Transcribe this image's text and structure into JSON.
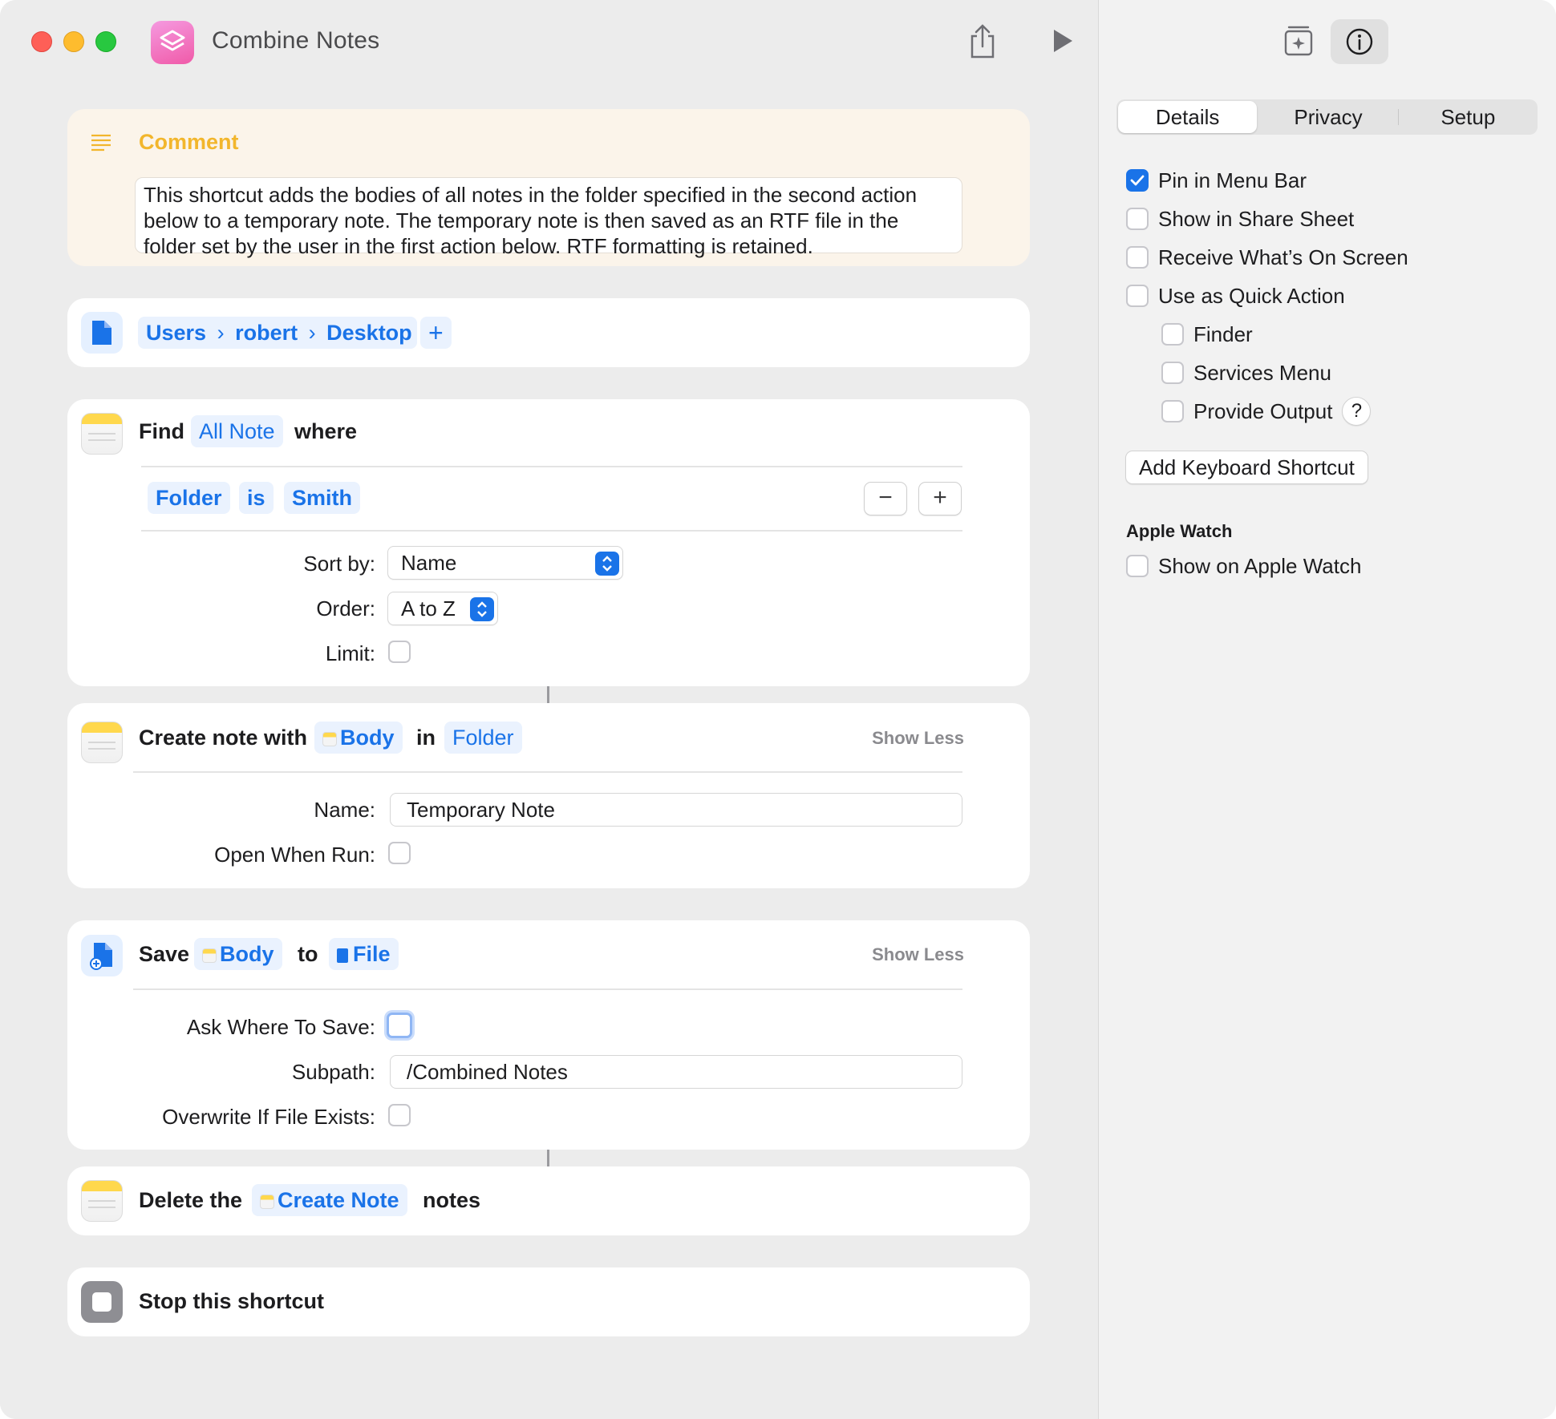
{
  "window": {
    "title": "Combine Notes"
  },
  "comment": {
    "title": "Comment",
    "text": "This shortcut adds the bodies of all notes in the folder specified in the second action below to a temporary note. The temporary note is then saved as an RTF file in the folder set by the user in the first action below. RTF formatting is retained."
  },
  "path_action": {
    "segments": [
      "Users",
      "robert",
      "Desktop"
    ],
    "add": "+"
  },
  "find_action": {
    "verb": "Find",
    "entity": "All Note",
    "where": "where",
    "filter": {
      "field": "Folder",
      "op": "is",
      "value": "Smith"
    },
    "minus": "−",
    "plus": "+",
    "sort_label": "Sort by:",
    "sort_value": "Name",
    "order_label": "Order:",
    "order_value": "A to Z",
    "limit_label": "Limit:"
  },
  "create_action": {
    "verb": "Create note with",
    "body": "Body",
    "in": "in",
    "folder": "Folder",
    "show_less": "Show Less",
    "name_label": "Name:",
    "name_value": "Temporary Note",
    "open_label": "Open When Run:"
  },
  "save_action": {
    "verb": "Save",
    "body": "Body",
    "to": "to",
    "file": "File",
    "show_less": "Show Less",
    "ask_label": "Ask Where To Save:",
    "subpath_label": "Subpath:",
    "subpath_value": "/Combined Notes",
    "overwrite_label": "Overwrite If File Exists:"
  },
  "delete_action": {
    "verb": "Delete the",
    "target": "Create Note",
    "suffix": "notes"
  },
  "stop_action": {
    "label": "Stop this shortcut"
  },
  "inspector": {
    "tabs": [
      "Details",
      "Privacy",
      "Setup"
    ],
    "options": {
      "pin_menu_bar": "Pin in Menu Bar",
      "share_sheet": "Show in Share Sheet",
      "on_screen": "Receive What’s On Screen",
      "quick_action": "Use as Quick Action",
      "finder": "Finder",
      "services_menu": "Services Menu",
      "provide_output": "Provide Output"
    },
    "help": "?",
    "keyboard_shortcut": "Add Keyboard Shortcut",
    "watch_section": "Apple Watch",
    "watch_option": "Show on Apple Watch"
  },
  "colors": {
    "accent": "#1a73e8",
    "comment_title": "#f2b62c",
    "comment_bg": "#fbf4ea",
    "token_bg": "#eaf2fe"
  }
}
